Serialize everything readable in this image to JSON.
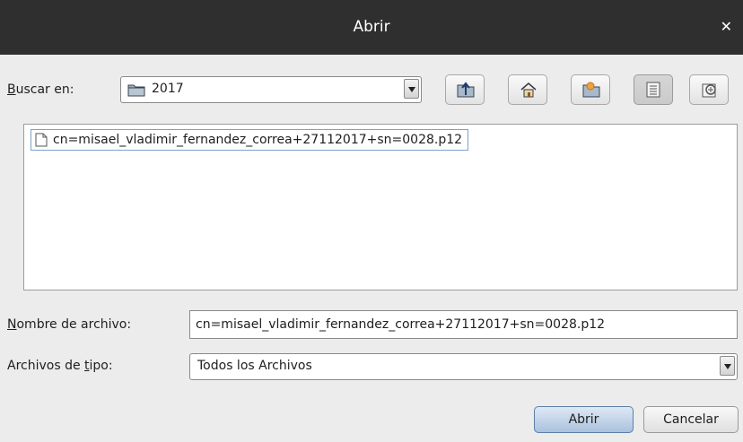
{
  "dialog": {
    "title": "Abrir"
  },
  "lookin": {
    "label_u": "B",
    "label_rest": "uscar en:",
    "value": "2017"
  },
  "toolbar": {
    "icons": [
      "up-folder-icon",
      "home-icon",
      "new-folder-icon",
      "list-view-icon",
      "details-view-icon"
    ]
  },
  "files": [
    {
      "name": "cn=misael_vladimir_fernandez_correa+27112017+sn=0028.p12"
    }
  ],
  "filename": {
    "label_u": "N",
    "label_rest": "ombre de archivo:",
    "value": "cn=misael_vladimir_fernandez_correa+27112017+sn=0028.p12"
  },
  "filetype": {
    "label_before": "Archivos de ",
    "label_u": "t",
    "label_after": "ipo:",
    "value": "Todos los Archivos"
  },
  "buttons": {
    "open": "Abrir",
    "cancel": "Cancelar"
  }
}
